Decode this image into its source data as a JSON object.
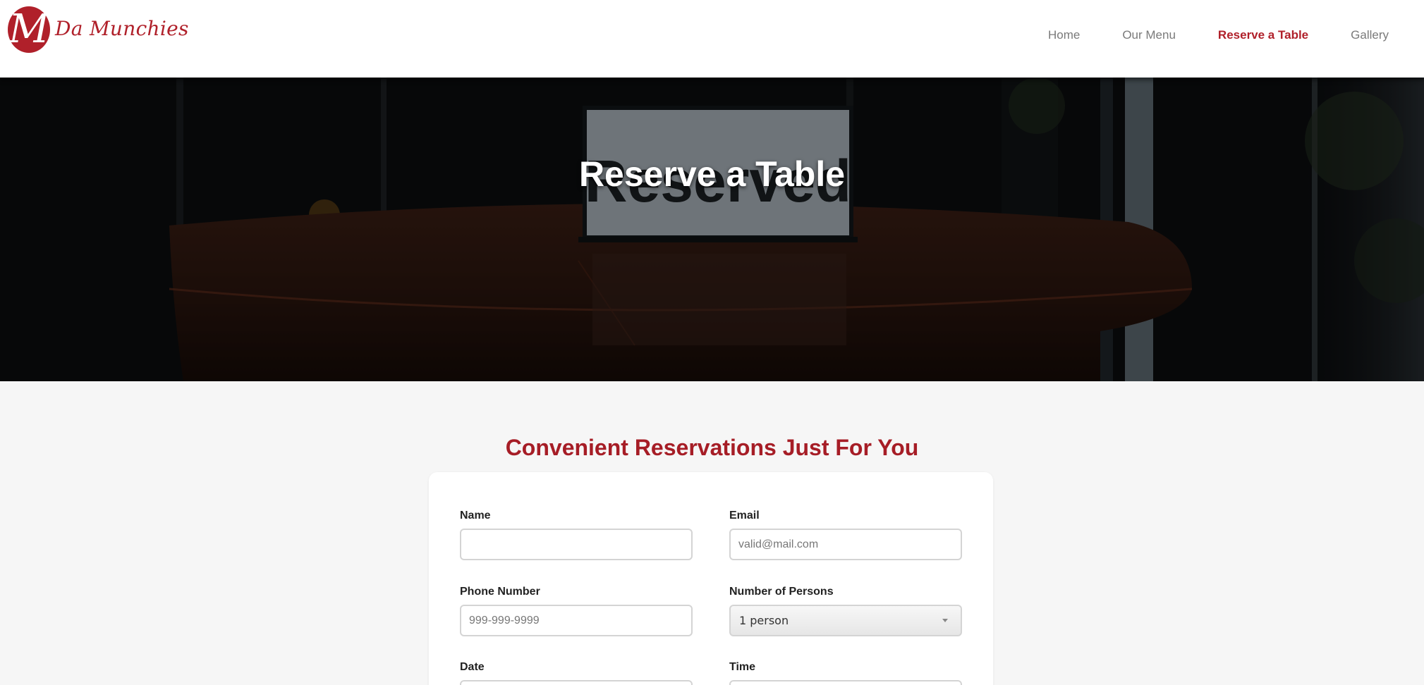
{
  "brand": {
    "name": "Da Munchies",
    "logo_letter": "M",
    "color": "#b0202a"
  },
  "nav": {
    "items": [
      {
        "label": "Home"
      },
      {
        "label": "Our Menu"
      },
      {
        "label": "Reserve a Table",
        "active": true
      },
      {
        "label": "Gallery"
      }
    ]
  },
  "hero": {
    "title": "Reserve a Table",
    "sign_text": "Reserved"
  },
  "reservation": {
    "heading": "Convenient Reservations Just For You",
    "fields": {
      "name": {
        "label": "Name",
        "value": "",
        "placeholder": ""
      },
      "email": {
        "label": "Email",
        "value": "",
        "placeholder": "valid@mail.com"
      },
      "phone": {
        "label": "Phone Number",
        "value": "",
        "placeholder": "999-999-9999"
      },
      "persons": {
        "label": "Number of Persons",
        "selected": "1 person"
      },
      "date": {
        "label": "Date"
      },
      "time": {
        "label": "Time"
      }
    }
  },
  "colors": {
    "accent": "#a61d26",
    "nav_inactive": "#7a7a7a",
    "page_bg": "#f6f6f6"
  }
}
